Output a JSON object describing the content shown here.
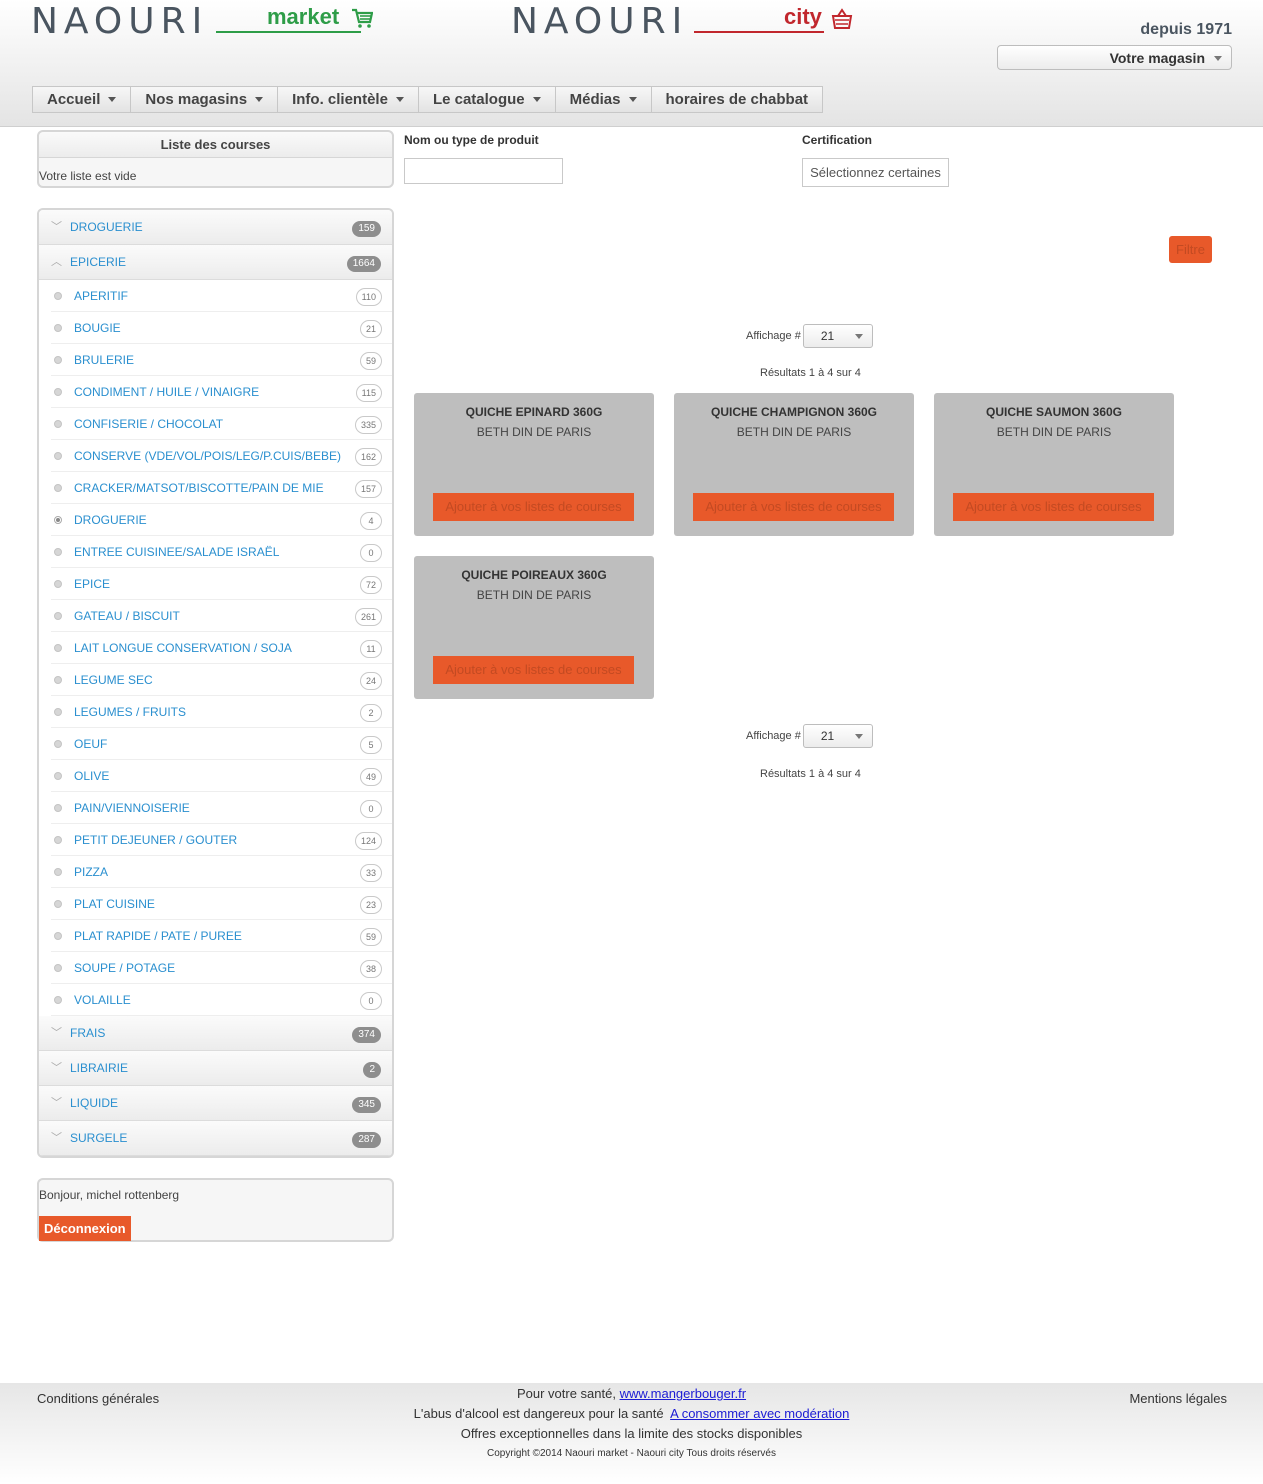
{
  "header": {
    "brand_market": "NAOURI",
    "brand_market_sub": "market",
    "brand_city": "NAOURI",
    "brand_city_sub": "city",
    "depuis": "depuis 1971",
    "store_select": "Votre magasin",
    "nav": [
      "Accueil",
      "Nos magasins",
      "Info. clientèle",
      "Le catalogue",
      "Médias",
      "horaires de chabbat"
    ],
    "brand_colors": {
      "market": "#2e9d48",
      "city": "#c1272d",
      "accent": "#e8592a"
    }
  },
  "shopping_list": {
    "title": "Liste des courses",
    "empty": "Votre liste est vide"
  },
  "categories": [
    {
      "label": "DROGUERIE",
      "count": "159",
      "expanded": false
    },
    {
      "label": "EPICERIE",
      "count": "1664",
      "expanded": true
    }
  ],
  "subcategories": [
    {
      "label": "APERITIF",
      "count": "110"
    },
    {
      "label": "BOUGIE",
      "count": "21"
    },
    {
      "label": "BRULERIE",
      "count": "59"
    },
    {
      "label": "CONDIMENT / HUILE / VINAIGRE",
      "count": "115"
    },
    {
      "label": "CONFISERIE / CHOCOLAT",
      "count": "335"
    },
    {
      "label": "CONSERVE (VDE/VOL/POIS/LEG/P.CUIS/BEBE)",
      "count": "162"
    },
    {
      "label": "CRACKER/MATSOT/BISCOTTE/PAIN DE MIE",
      "count": "157"
    },
    {
      "label": "DROGUERIE",
      "count": "4",
      "selected": true
    },
    {
      "label": "ENTREE CUISINEE/SALADE ISRAËL",
      "count": "0"
    },
    {
      "label": "EPICE",
      "count": "72"
    },
    {
      "label": "GATEAU / BISCUIT",
      "count": "261"
    },
    {
      "label": "LAIT LONGUE CONSERVATION / SOJA",
      "count": "11"
    },
    {
      "label": "LEGUME SEC",
      "count": "24"
    },
    {
      "label": "LEGUMES / FRUITS",
      "count": "2"
    },
    {
      "label": "OEUF",
      "count": "5"
    },
    {
      "label": "OLIVE",
      "count": "49"
    },
    {
      "label": "PAIN/VIENNOISERIE",
      "count": "0"
    },
    {
      "label": "PETIT DEJEUNER / GOUTER",
      "count": "124"
    },
    {
      "label": "PIZZA",
      "count": "33"
    },
    {
      "label": "PLAT CUISINE",
      "count": "23"
    },
    {
      "label": "PLAT RAPIDE / PATE / PUREE",
      "count": "59"
    },
    {
      "label": "SOUPE / POTAGE",
      "count": "38"
    },
    {
      "label": "VOLAILLE",
      "count": "0"
    }
  ],
  "categories_after": [
    {
      "label": "FRAIS",
      "count": "374"
    },
    {
      "label": "LIBRAIRIE",
      "count": "2"
    },
    {
      "label": "LIQUIDE",
      "count": "345"
    },
    {
      "label": "SURGELE",
      "count": "287"
    }
  ],
  "user": {
    "greeting": "Bonjour, michel rottenberg",
    "logout": "Déconnexion"
  },
  "filters": {
    "product_label": "Nom ou type de produit",
    "product_value": "",
    "cert_label": "Certification",
    "cert_button": "Sélectionnez certaines",
    "filter_button": "Filtre"
  },
  "pagination": {
    "affichage_label": "Affichage #",
    "per_page": "21",
    "results": "Résultats 1 à 4 sur 4"
  },
  "products": [
    {
      "name": "QUICHE EPINARD 360G",
      "brand": "BETH DIN DE PARIS",
      "button": "Ajouter à vos listes de courses"
    },
    {
      "name": "QUICHE CHAMPIGNON 360G",
      "brand": "BETH DIN DE PARIS",
      "button": "Ajouter à vos listes de courses"
    },
    {
      "name": "QUICHE SAUMON 360G",
      "brand": "BETH DIN DE PARIS",
      "button": "Ajouter à vos listes de courses"
    },
    {
      "name": "QUICHE POIREAUX 360G",
      "brand": "BETH DIN DE PARIS",
      "button": "Ajouter à vos listes de courses"
    }
  ],
  "footer": {
    "conditions": "Conditions générales",
    "mentions": "Mentions légales",
    "health_text": "Pour votre santé,",
    "health_link": "www.mangerbouger.fr",
    "alcohol_text": "L'abus d'alcool est dangereux pour la santé",
    "alcohol_link": "A consommer avec modération",
    "offers": "Offres exceptionnelles dans la limite des stocks disponibles",
    "copyright": "Copyright ©2014   Naouri market - Naouri city Tous droits réservés"
  }
}
